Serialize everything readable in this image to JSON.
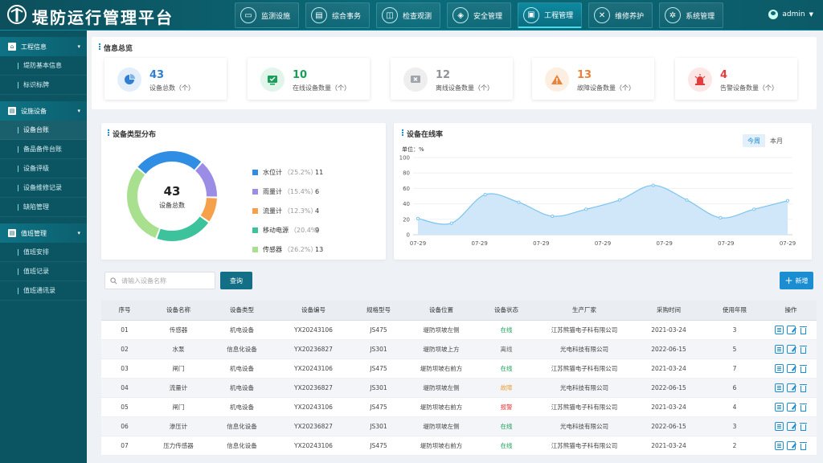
{
  "app": {
    "title": "堤防运行管理平台",
    "user": "admin"
  },
  "nav": [
    {
      "label": "监测设施",
      "icon": "monitor-icon"
    },
    {
      "label": "综合事务",
      "icon": "document-icon"
    },
    {
      "label": "检查观测",
      "icon": "inspection-icon"
    },
    {
      "label": "安全管理",
      "icon": "shield-icon"
    },
    {
      "label": "工程管理",
      "icon": "engineering-icon",
      "active": true
    },
    {
      "label": "维修养护",
      "icon": "wrench-icon"
    },
    {
      "label": "系统管理",
      "icon": "gear-icon"
    }
  ],
  "sidebar": {
    "groups": [
      {
        "label": "工程信息",
        "items": [
          "堤防基本信息",
          "标识标牌"
        ]
      },
      {
        "label": "设施设备",
        "items": [
          "设备台账",
          "备品备件台账",
          "设备评级",
          "设备维修记录",
          "缺陷管理"
        ]
      },
      {
        "label": "值班管理",
        "items": [
          "值班安排",
          "值班记录",
          "值班通讯录"
        ]
      }
    ],
    "active": "设备台账"
  },
  "overview": {
    "title": "信息总览",
    "cards": [
      {
        "value": "43",
        "label": "设备总数（个）",
        "color": "#2f7fd6",
        "bg": "#e3eefb",
        "icon": "pie-icon"
      },
      {
        "value": "10",
        "label": "在线设备数量（个）",
        "color": "#18a058",
        "bg": "#e2f5ea",
        "icon": "online-icon"
      },
      {
        "value": "12",
        "label": "离线设备数量（个）",
        "color": "#909399",
        "bg": "#eeeeee",
        "icon": "offline-icon"
      },
      {
        "value": "13",
        "label": "故障设备数量（个）",
        "color": "#e8833a",
        "bg": "#fdeee2",
        "icon": "warning-icon"
      },
      {
        "value": "4",
        "label": "告警设备数量（个）",
        "color": "#e23c3c",
        "bg": "#fde6e6",
        "icon": "alarm-icon"
      }
    ]
  },
  "type_panel": {
    "title": "设备类型分布",
    "center_value": "43",
    "center_label": "设备总数"
  },
  "online_panel": {
    "title": "设备在线率",
    "unit": "单位：%",
    "tabs": [
      "今周",
      "本月"
    ]
  },
  "chart_data": [
    {
      "type": "pie",
      "categories": [
        "水位计",
        "雨量计",
        "流量计",
        "移动电源",
        "传感器"
      ],
      "values": [
        11,
        6,
        4,
        9,
        13
      ],
      "percent_labels": [
        "（25.2%）",
        "（15.4%）",
        "（12.3%）",
        "（20.4%）",
        "（26.2%）"
      ],
      "colors": [
        "#2f8de4",
        "#9b8de6",
        "#f5a14b",
        "#3cc39c",
        "#a9e08f"
      ]
    },
    {
      "type": "area",
      "x": [
        "07-29",
        "07-29",
        "07-29",
        "07-29",
        "07-29",
        "07-29",
        "07-29"
      ],
      "y": [
        21,
        15,
        52,
        42,
        24,
        33,
        45,
        64,
        45,
        22,
        33,
        44
      ],
      "ylim": [
        0,
        100
      ],
      "yticks": [
        0,
        20,
        40,
        60,
        80,
        100
      ],
      "color": "#7cc4ee"
    }
  ],
  "toolbar": {
    "search_placeholder": "请输入设备名称",
    "query": "查询",
    "add": "新增"
  },
  "table": {
    "headers": [
      "序号",
      "设备名称",
      "设备类型",
      "设备编号",
      "规格型号",
      "设备位置",
      "设备状态",
      "生产厂家",
      "采购时间",
      "使用年限",
      "操作"
    ],
    "rows": [
      [
        "01",
        "传感器",
        "机电设备",
        "YX20243106",
        "JS475",
        "堤防坝坡左侧",
        "在线",
        "江苏熊猫电子科有限公司",
        "2021-03-24",
        "3"
      ],
      [
        "02",
        "水泵",
        "信息化设备",
        "YX20236827",
        "JS301",
        "堤防坝坡上方",
        "离线",
        "光电科技有限公司",
        "2022-06-15",
        "5"
      ],
      [
        "03",
        "闸门",
        "机电设备",
        "YX20243106",
        "JS475",
        "堤防坝坡右前方",
        "在线",
        "江苏熊猫电子科有限公司",
        "2021-03-24",
        "7"
      ],
      [
        "04",
        "流量计",
        "机电设备",
        "YX20236827",
        "JS301",
        "堤防坝坡左侧",
        "故障",
        "光电科技有限公司",
        "2022-06-15",
        "6"
      ],
      [
        "05",
        "闸门",
        "机电设备",
        "YX20243106",
        "JS475",
        "堤防坝坡右前方",
        "报警",
        "江苏熊猫电子科有限公司",
        "2021-03-24",
        "4"
      ],
      [
        "06",
        "渗压计",
        "信息化设备",
        "YX20236827",
        "JS301",
        "堤防坝坡左侧",
        "在线",
        "光电科技有限公司",
        "2022-06-15",
        "3"
      ],
      [
        "07",
        "压力传感器",
        "信息化设备",
        "YX20243106",
        "JS475",
        "堤防坝坡右前方",
        "在线",
        "江苏熊猫电子科有限公司",
        "2021-03-24",
        "2"
      ]
    ],
    "status_colors": {
      "在线": "#18a058",
      "离线": "#666666",
      "故障": "#e8a33a",
      "报警": "#e23c3c"
    }
  }
}
